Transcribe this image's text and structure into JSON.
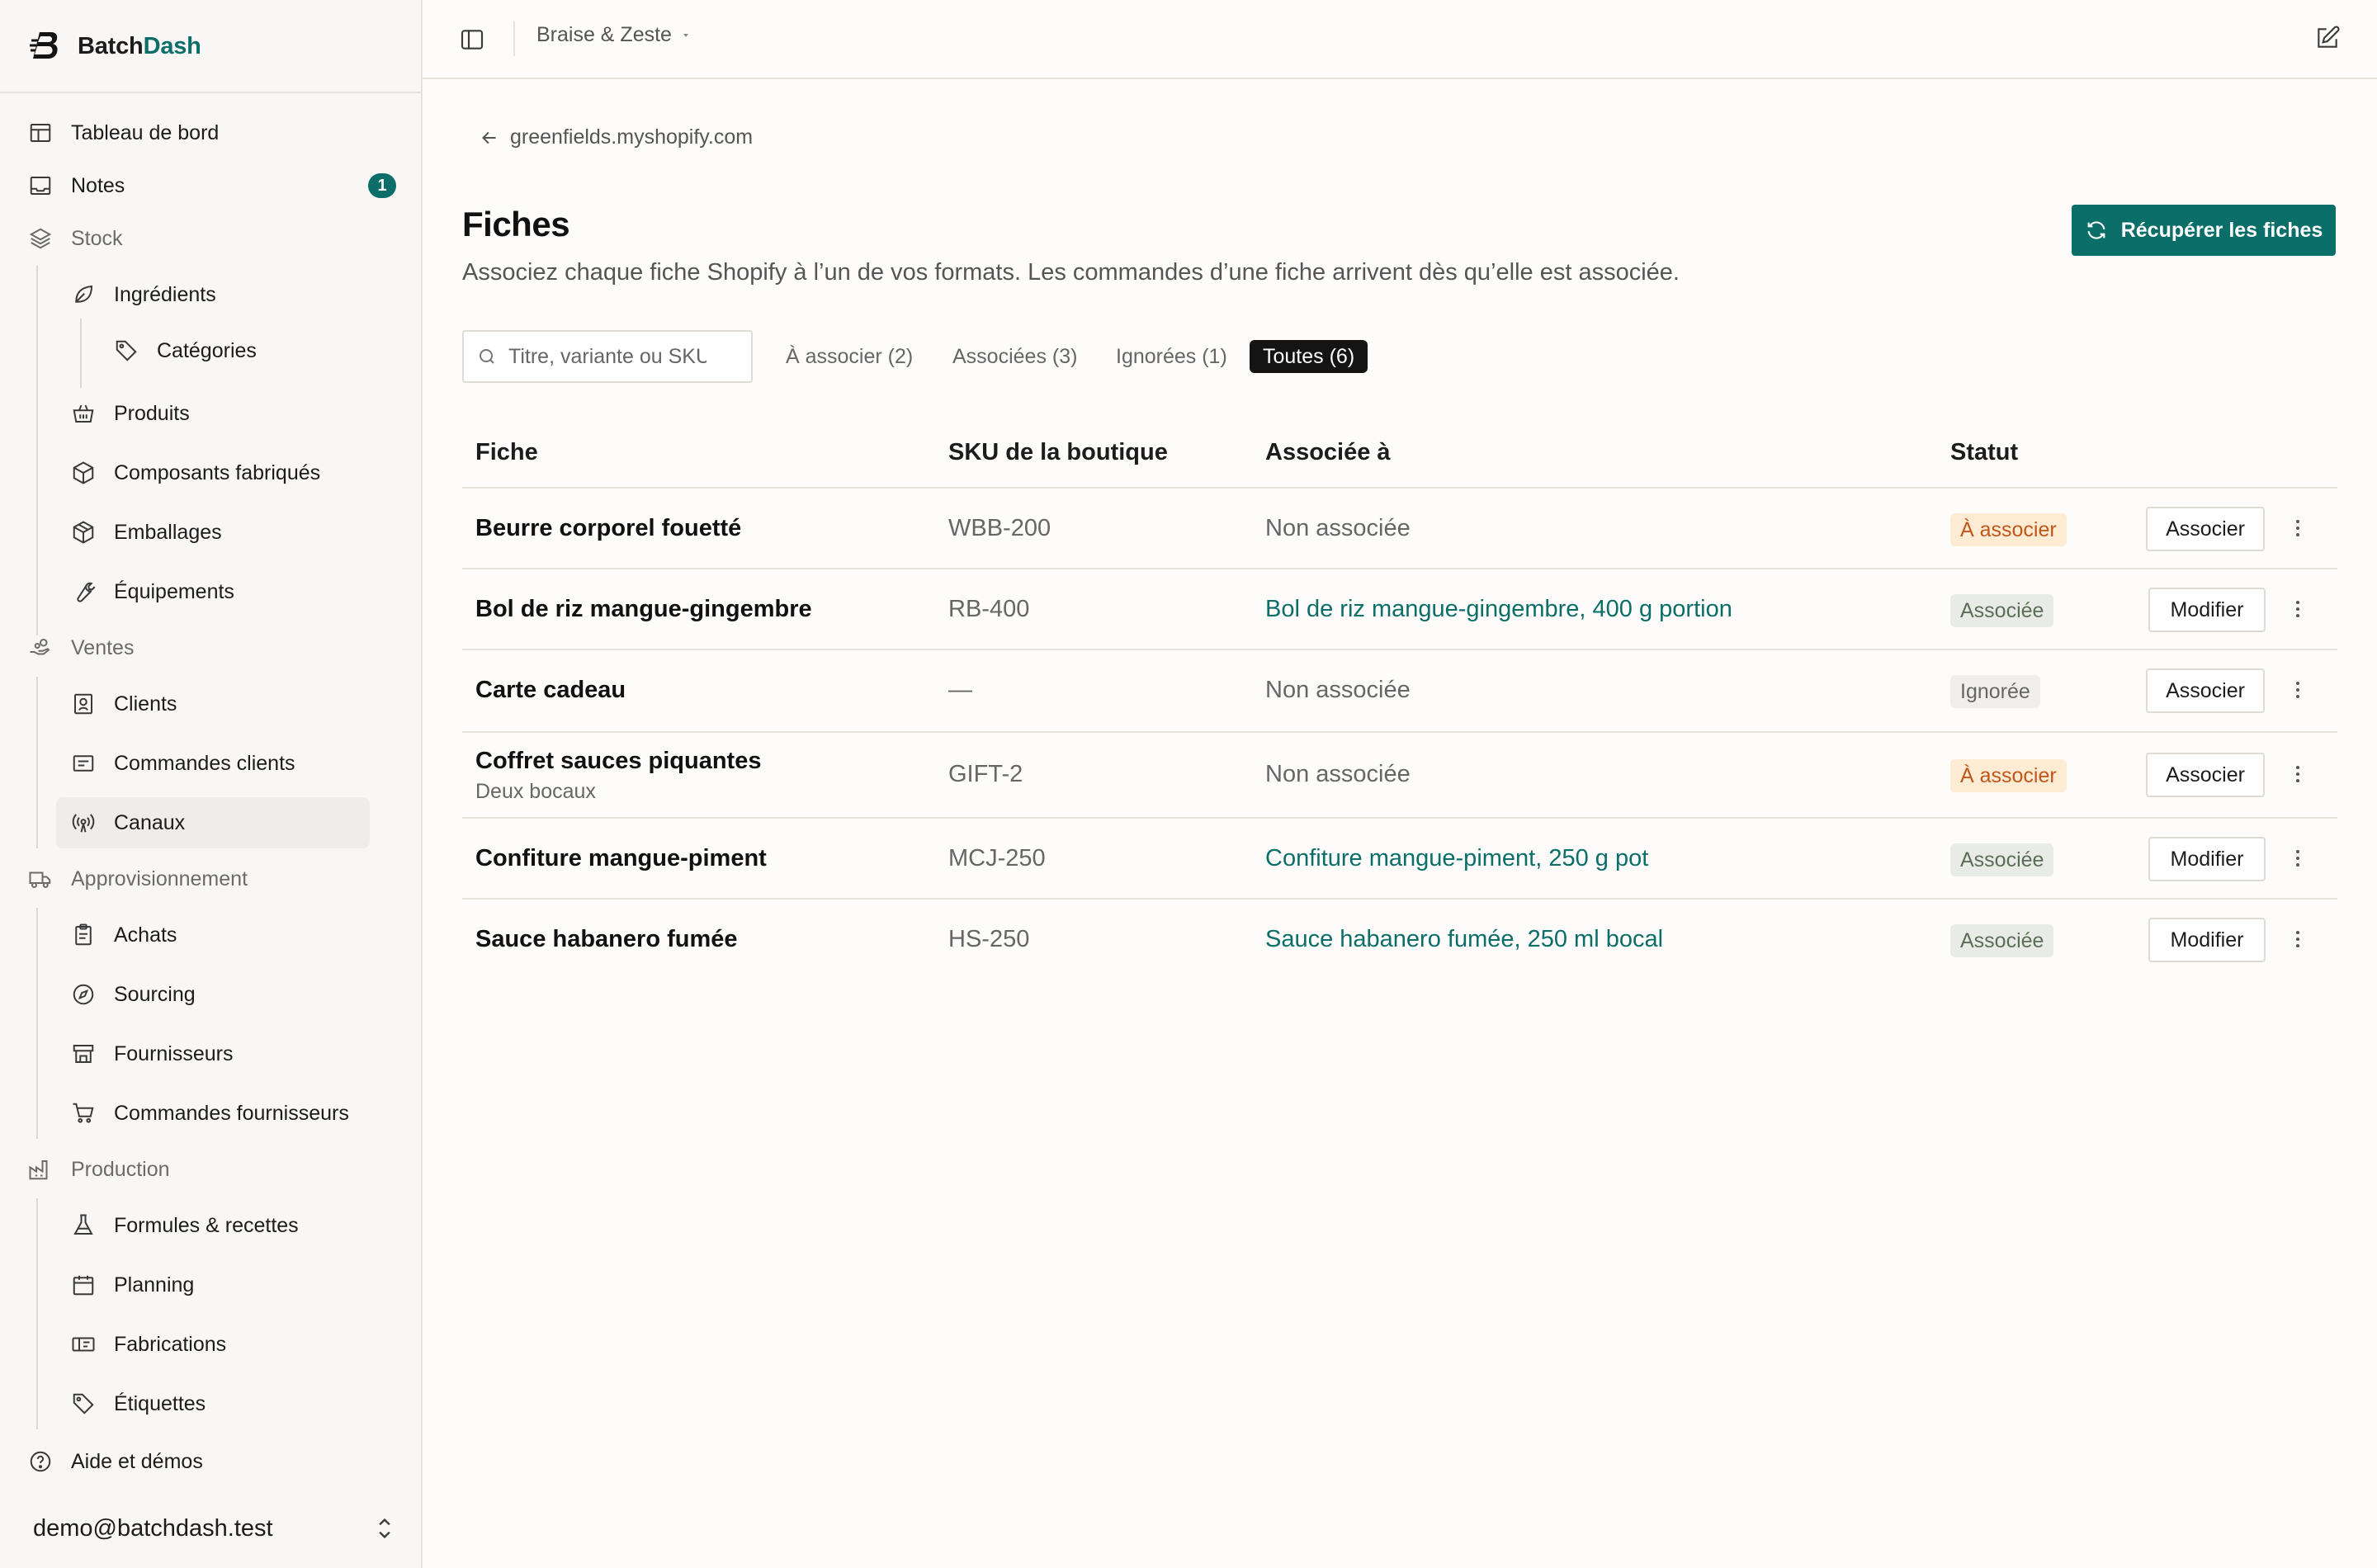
{
  "brand": {
    "name_part1": "Batch",
    "name_part2": "Dash"
  },
  "workspace": {
    "name": "Braise & Zeste"
  },
  "sidebar": {
    "items": [
      {
        "label": "Tableau de bord"
      },
      {
        "label": "Notes",
        "badge": "1"
      },
      {
        "label": "Stock"
      },
      {
        "label": "Ingrédients"
      },
      {
        "label": "Catégories"
      },
      {
        "label": "Produits"
      },
      {
        "label": "Composants fabriqués"
      },
      {
        "label": "Emballages"
      },
      {
        "label": "Équipements"
      },
      {
        "label": "Ventes"
      },
      {
        "label": "Clients"
      },
      {
        "label": "Commandes clients"
      },
      {
        "label": "Canaux"
      },
      {
        "label": "Approvisionnement"
      },
      {
        "label": "Achats"
      },
      {
        "label": "Sourcing"
      },
      {
        "label": "Fournisseurs"
      },
      {
        "label": "Commandes fournisseurs"
      },
      {
        "label": "Production"
      },
      {
        "label": "Formules & recettes"
      },
      {
        "label": "Planning"
      },
      {
        "label": "Fabrications"
      },
      {
        "label": "Étiquettes"
      },
      {
        "label": "Aide et démos"
      }
    ],
    "user_email": "demo@batchdash.test"
  },
  "main": {
    "back_label": "greenfields.myshopify.com",
    "title": "Fiches",
    "subtitle": "Associez chaque fiche Shopify à l’un de vos formats. Les commandes d’une fiche arrivent dès qu’elle est associée.",
    "fetch_button": "Récupérer les fiches",
    "search_placeholder": "Titre, variante ou SKU",
    "tabs": [
      {
        "label": "À associer (2)"
      },
      {
        "label": "Associées (3)"
      },
      {
        "label": "Ignorées (1)"
      },
      {
        "label": "Toutes (6)",
        "active": true
      }
    ],
    "table": {
      "headers": [
        "Fiche",
        "SKU de la boutique",
        "Associée à",
        "Statut"
      ],
      "rows": [
        {
          "name": "Beurre corporel fouetté",
          "sku": "WBB-200",
          "associated": "Non associée",
          "status": "À associer",
          "action": "Associer"
        },
        {
          "name": "Bol de riz mangue-gingembre",
          "sku": "RB-400",
          "associated": "Bol de riz mangue-gingembre, 400 g portion",
          "status": "Associée",
          "action": "Modifier"
        },
        {
          "name": "Carte cadeau",
          "sku": "—",
          "associated": "Non associée",
          "status": "Ignorée",
          "action": "Associer"
        },
        {
          "name": "Coffret sauces piquantes",
          "variant": "Deux bocaux",
          "sku": "GIFT-2",
          "associated": "Non associée",
          "status": "À associer",
          "action": "Associer"
        },
        {
          "name": "Confiture mangue-piment",
          "sku": "MCJ-250",
          "associated": "Confiture mangue-piment, 250 g pot",
          "status": "Associée",
          "action": "Modifier"
        },
        {
          "name": "Sauce habanero fumée",
          "sku": "HS-250",
          "associated": "Sauce habanero fumée, 250 ml bocal",
          "status": "Associée",
          "action": "Modifier"
        }
      ]
    }
  },
  "colors": {
    "accent": "#0c6e69",
    "pending_bg": "#fdebd3",
    "pending_text": "#c0561a",
    "linked_bg": "#e9ece6"
  }
}
